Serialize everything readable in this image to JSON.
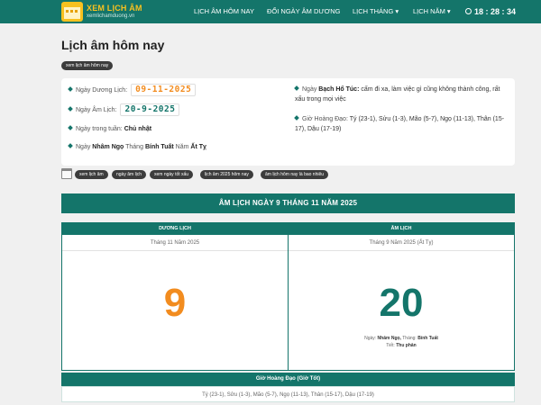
{
  "brand": {
    "name": "XEM LỊCH ÂM",
    "url": "xemlichamduong.vn"
  },
  "nav": [
    {
      "label": "LỊCH ÂM HÔM NAY"
    },
    {
      "label": "ĐỔI NGÀY ÂM DƯƠNG"
    },
    {
      "label": "LỊCH THÁNG ▾"
    },
    {
      "label": "LỊCH NĂM ▾"
    }
  ],
  "clock": "18 : 28 : 34",
  "page_title": "Lịch âm hôm nay",
  "title_tag": "xem lịch âm hôm nay",
  "info": {
    "duong_label": "Ngày Dương Lịch:",
    "duong_value": "09-11-2025",
    "am_label": "Ngày Âm Lịch:",
    "am_value": "20-9-2025",
    "weekday_label": "Ngày trong tuần:",
    "weekday_value": "Chủ nhật",
    "canchi_p1": "Ngày",
    "canchi_day": "Nhâm Ngọ",
    "canchi_p2": "Tháng",
    "canchi_month": "Bính Tuất",
    "canchi_p3": "Năm",
    "canchi_year": "Ất Tỵ",
    "bach_label": "Ngày",
    "bach_value": "Bạch Hổ Túc:",
    "bach_desc": "cấm đi xa, làm việc gì cũng không thành công, rất xấu trong mọi việc",
    "gio_label": "Giờ Hoàng Đạo:",
    "gio_value": "Tý (23-1), Sửu (1-3), Mão (5-7), Ngọ (11-13), Thân (15-17), Dậu (17-19)"
  },
  "tags": [
    "xem lịch âm",
    "ngày âm lịch",
    "xem ngày tốt xấu",
    "lịch âm 2025 hôm nay",
    "âm lịch hôm nay là bao nhiêu"
  ],
  "banner": "ÂM LỊCH NGÀY 9 THÁNG 11 NĂM 2025",
  "duong_col": {
    "header": "DƯƠNG LỊCH",
    "sub": "Tháng 11 Năm 2025",
    "day": "9"
  },
  "am_col": {
    "header": "ÂM LỊCH",
    "sub": "Tháng 9 Năm 2025 (Ất Tỵ)",
    "day": "20",
    "meta_ngay_label": "Ngày:",
    "meta_ngay": "Nhâm Ngọ,",
    "meta_thang_label": "Tháng:",
    "meta_thang": "Bính Tuất",
    "meta_tiet_label": "Tiết:",
    "meta_tiet": "Thu phân"
  },
  "gio_tot": {
    "header": "Giờ Hoàng Đạo (Giờ Tốt)",
    "value": "Tý (23-1), Sửu (1-3), Mão (5-7), Ngọ (11-13), Thân (15-17), Dậu (17-19)"
  },
  "colors": {
    "primary": "#14756a",
    "accent": "#f28c1f",
    "logo": "#f7c11f"
  }
}
